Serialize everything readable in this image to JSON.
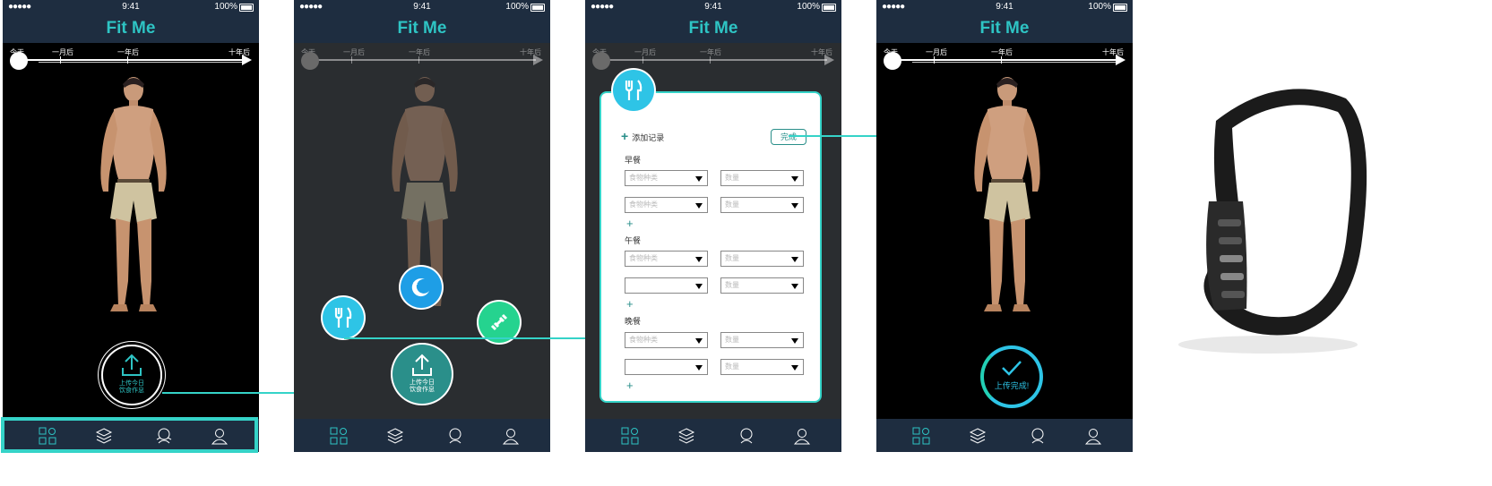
{
  "app": {
    "title": "Fit Me",
    "brand_color": "#2ec4c4",
    "accent_color": "#35d3c8"
  },
  "status_bar": {
    "signal": "●●●●●",
    "time": "9:41",
    "battery": "100%"
  },
  "timeline": {
    "labels": [
      "今天",
      "一月后",
      "一年后",
      "十年后"
    ]
  },
  "screen1": {
    "upload_label_line1": "上传今日",
    "upload_label_line2": "饮食作息"
  },
  "screen2": {
    "upload_label_line1": "上传今日",
    "upload_label_line2": "饮食作息",
    "buttons": [
      "diet-icon",
      "sleep-icon",
      "exercise-icon"
    ]
  },
  "screen3": {
    "add_record": "添加记录",
    "done": "完成",
    "meals": [
      {
        "label": "早餐",
        "rows": [
          {
            "food": "食物种类",
            "qty": "数量"
          },
          {
            "food": "食物种类",
            "qty": "数量"
          }
        ]
      },
      {
        "label": "午餐",
        "rows": [
          {
            "food": "食物种类",
            "qty": "数量"
          },
          {
            "food": "",
            "qty": "数量"
          }
        ]
      },
      {
        "label": "晚餐",
        "rows": [
          {
            "food": "食物种类",
            "qty": "数量"
          },
          {
            "food": "",
            "qty": "数量"
          }
        ]
      }
    ],
    "add_row_symbol": "+"
  },
  "screen4": {
    "done_label": "上传完成!"
  },
  "tabbar": {
    "tabs": [
      "dashboard-icon",
      "layers-icon",
      "body-icon",
      "profile-icon"
    ]
  }
}
